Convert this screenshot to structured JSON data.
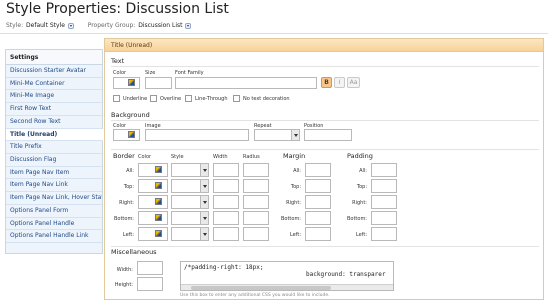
{
  "page": {
    "title": "Style Properties: Discussion List"
  },
  "filters": {
    "style_label": "Style:",
    "style_value": "Default Style",
    "group_label": "Property Group:",
    "group_value": "Discussion List"
  },
  "sidebar": {
    "header": "Settings",
    "items": [
      {
        "label": "Discussion Starter Avatar"
      },
      {
        "label": "Mini-Me Container"
      },
      {
        "label": "Mini-Me Image"
      },
      {
        "label": "First Row Text"
      },
      {
        "label": "Second Row Text"
      },
      {
        "label": "Title (Unread)"
      },
      {
        "label": "Title Prefix"
      },
      {
        "label": "Discussion Flag"
      },
      {
        "label": "Item Page Nav Item"
      },
      {
        "label": "Item Page Nav Link"
      },
      {
        "label": "Item Page Nav Link, Hover State"
      },
      {
        "label": "Options Panel Form"
      },
      {
        "label": "Options Panel Handle"
      },
      {
        "label": "Options Panel Handle Link"
      }
    ],
    "active_index": 5
  },
  "panel": {
    "title": "Title (Unread)",
    "text_section": {
      "title": "Text",
      "color_label": "Color",
      "size_label": "Size",
      "font_family_label": "Font Family",
      "bold_btn": "B",
      "italic_btn": "I",
      "smallcaps_btn": "Aa",
      "bold_active": true,
      "underline_label": "Underline",
      "overline_label": "Overline",
      "linethrough_label": "Line-Through",
      "notextdeco_label": "No text decoration"
    },
    "background_section": {
      "title": "Background",
      "color_label": "Color",
      "image_label": "Image",
      "repeat_label": "Repeat",
      "position_label": "Position"
    },
    "border_section": {
      "title": "Border",
      "color_label": "Color",
      "style_label": "Style",
      "width_label": "Width",
      "radius_label": "Radius",
      "rows": [
        "All:",
        "Top:",
        "Right:",
        "Bottom:",
        "Left:"
      ]
    },
    "margin_section": {
      "title": "Margin",
      "rows": [
        "All:",
        "Top:",
        "Right:",
        "Bottom:",
        "Left:"
      ]
    },
    "padding_section": {
      "title": "Padding",
      "rows": [
        "All:",
        "Top:",
        "Right:",
        "Bottom:",
        "Left:"
      ]
    },
    "misc_section": {
      "title": "Miscellaneous",
      "width_label": "Width:",
      "height_label": "Height:",
      "css_line1": "/*padding-right: 18px;",
      "css_line2": "background: transparer",
      "hint": "Use this box to enter any additional CSS you would like to include."
    }
  },
  "colors": {
    "panel_header_bg": "#f8d39a",
    "sidebar_bg": "#eef4fb",
    "link_color": "#204a87"
  }
}
